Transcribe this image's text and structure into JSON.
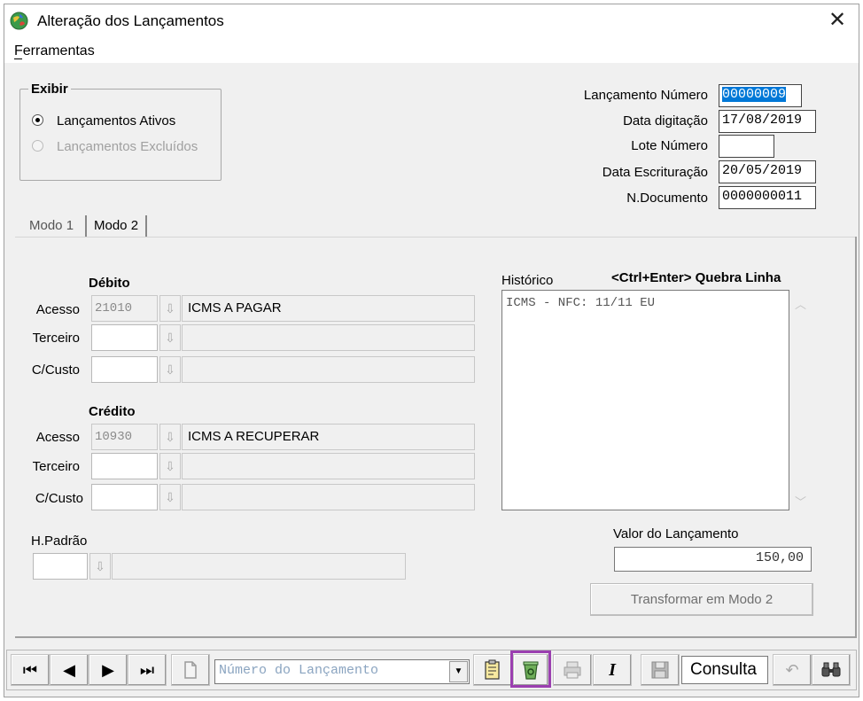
{
  "window": {
    "title": "Alteração dos Lançamentos",
    "close_glyph": "✕",
    "app_icon": "app-globe-icon"
  },
  "menu": {
    "ferramentas": "Ferramentas"
  },
  "exibir": {
    "title": "Exibir",
    "options": [
      {
        "label": "Lançamentos Ativos",
        "checked": true,
        "enabled": true
      },
      {
        "label": "Lançamentos Excluídos",
        "checked": false,
        "enabled": false
      }
    ]
  },
  "header_fields": {
    "lancamento_numero": {
      "label": "Lançamento Número",
      "value": "00000009"
    },
    "data_digitacao": {
      "label": "Data digitação",
      "value": "17/08/2019"
    },
    "lote_numero": {
      "label": "Lote Número",
      "value": ""
    },
    "data_escrituracao": {
      "label": "Data Escrituração",
      "value": "20/05/2019"
    },
    "n_documento": {
      "label": "N.Documento",
      "value": "0000000011"
    }
  },
  "tabs": [
    {
      "label": "Modo 1",
      "active": true
    },
    {
      "label": "Modo 2",
      "active": false
    }
  ],
  "debito": {
    "title": "Débito",
    "acesso_label": "Acesso",
    "acesso_code": "21010",
    "acesso_desc": "ICMS A PAGAR",
    "terceiro_label": "Terceiro",
    "ccusto_label": "C/Custo"
  },
  "credito": {
    "title": "Crédito",
    "acesso_label": "Acesso",
    "acesso_code": "10930",
    "acesso_desc": "ICMS A RECUPERAR",
    "terceiro_label": "Terceiro",
    "ccusto_label": "C/Custo"
  },
  "hpadrao": {
    "label": "H.Padrão"
  },
  "historico": {
    "label": "Histórico",
    "hint": "<Ctrl+Enter> Quebra Linha",
    "text": "ICMS - NFC: 11/11 EU"
  },
  "valor": {
    "label": "Valor do Lançamento",
    "value": "150,00"
  },
  "transformar_button": "Transformar em Modo 2",
  "toolbar": {
    "search_placeholder": "Número do Lançamento",
    "mode_value": "Consulta",
    "first": "⏮",
    "prev": "◀",
    "next": "▶",
    "last": "⏭",
    "dropdown_glyph": "▼",
    "italic": "I"
  },
  "colors": {
    "highlight_border": "#9b3fb0",
    "selection": "#0078d7"
  }
}
